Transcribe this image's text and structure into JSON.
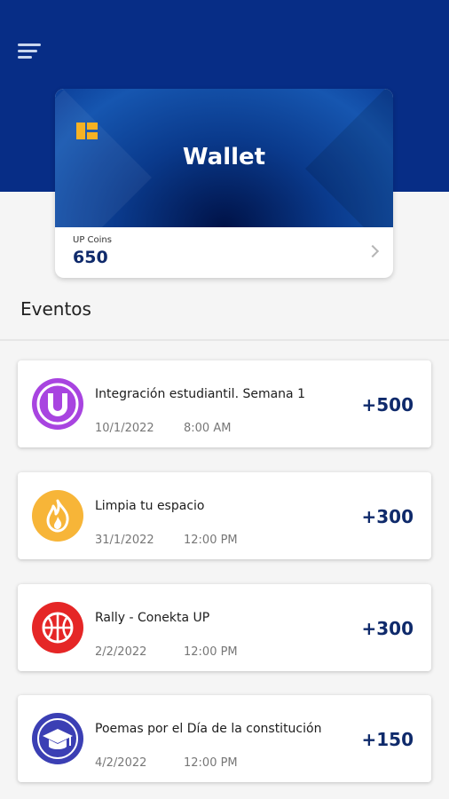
{
  "wallet": {
    "title": "Wallet",
    "coins_label": "UP Coins",
    "coins_value": "650"
  },
  "section": {
    "title": "Eventos"
  },
  "events": [
    {
      "name": "Integración estudiantil. Semana 1",
      "date": "10/1/2022",
      "time": "8:00 AM",
      "points": "+500",
      "icon": "u-logo-icon",
      "color": "#a844e0"
    },
    {
      "name": "Limpia tu espacio",
      "date": "31/1/2022",
      "time": "12:00 PM",
      "points": "+300",
      "icon": "flame-icon",
      "color": "#f7b538"
    },
    {
      "name": "Rally - Conekta UP",
      "date": "2/2/2022",
      "time": "12:00 PM",
      "points": "+300",
      "icon": "basketball-icon",
      "color": "#e52626"
    },
    {
      "name": "Poemas por el Día de la constitución",
      "date": "4/2/2022",
      "time": "12:00 PM",
      "points": "+150",
      "icon": "graduation-cap-icon",
      "color": "#3b3fb4"
    }
  ]
}
